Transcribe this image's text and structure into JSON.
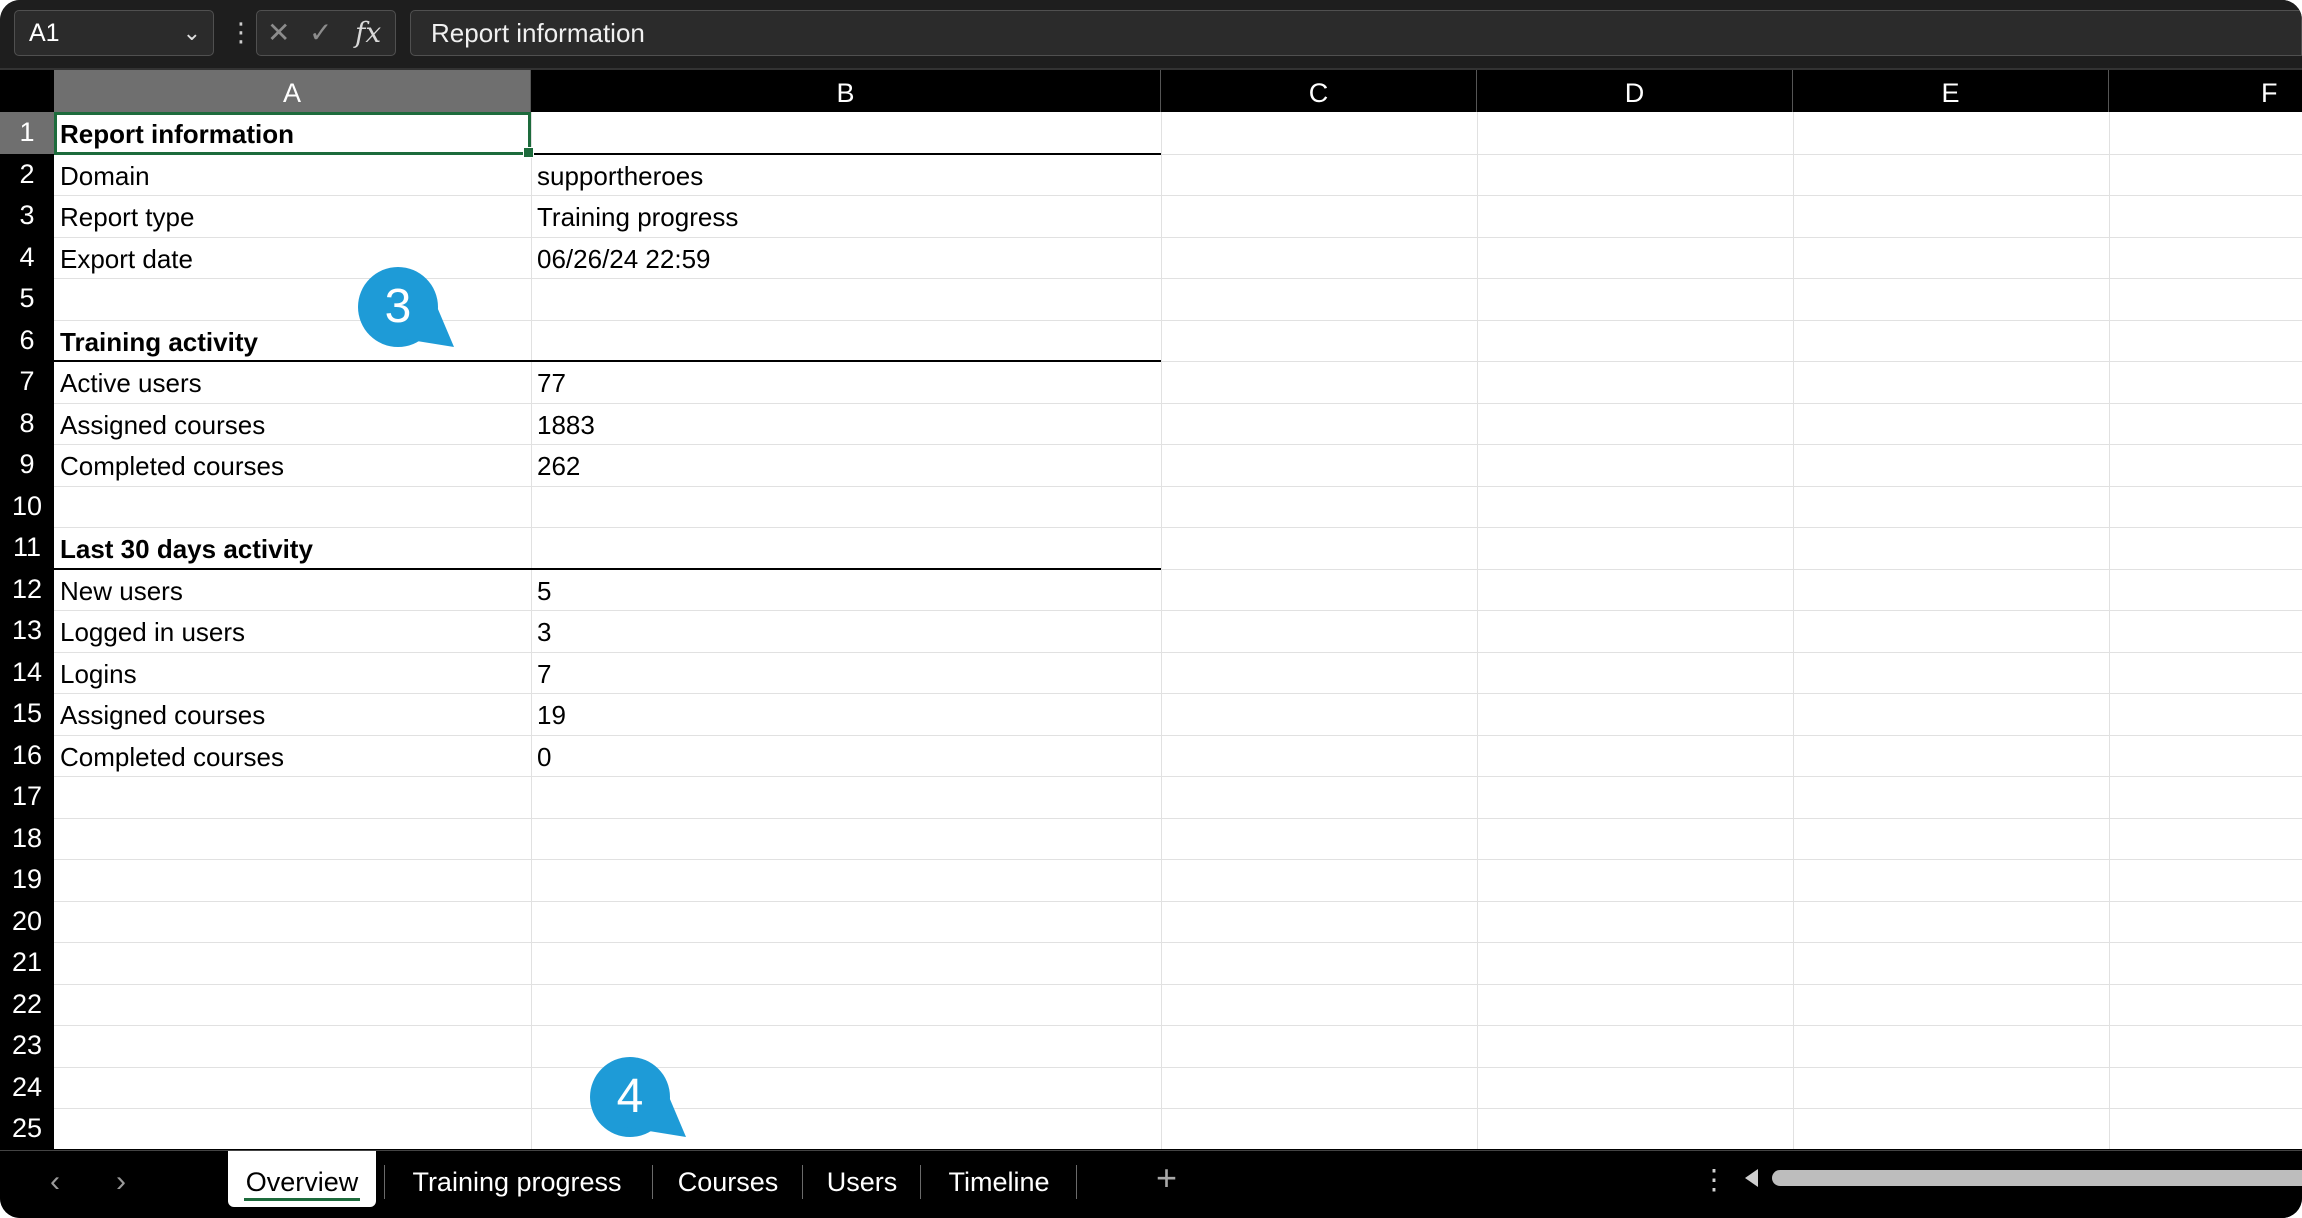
{
  "formula_bar": {
    "name_box": "A1",
    "formula": "Report information",
    "fx": "fx"
  },
  "columns": [
    "A",
    "B",
    "C",
    "D",
    "E",
    "F"
  ],
  "rows": [
    "1",
    "2",
    "3",
    "4",
    "5",
    "6",
    "7",
    "8",
    "9",
    "10",
    "11",
    "12",
    "13",
    "14",
    "15",
    "16",
    "17",
    "18",
    "19",
    "20",
    "21",
    "22",
    "23",
    "24",
    "25"
  ],
  "cells": {
    "r1": {
      "a": "Report information",
      "b": ""
    },
    "r2": {
      "a": "Domain",
      "b": "supportheroes"
    },
    "r3": {
      "a": "Report type",
      "b": "Training progress"
    },
    "r4": {
      "a": "Export date",
      "b": "06/26/24 22:59"
    },
    "r6": {
      "a": "Training activity",
      "b": ""
    },
    "r7": {
      "a": "Active users",
      "b": "77"
    },
    "r8": {
      "a": "Assigned courses",
      "b": "1883"
    },
    "r9": {
      "a": "Completed courses",
      "b": "262"
    },
    "r11": {
      "a": "Last 30 days activity",
      "b": ""
    },
    "r12": {
      "a": "New users",
      "b": "5"
    },
    "r13": {
      "a": "Logged in users",
      "b": "3"
    },
    "r14": {
      "a": "Logins",
      "b": "7"
    },
    "r15": {
      "a": "Assigned courses",
      "b": "19"
    },
    "r16": {
      "a": "Completed courses",
      "b": "0"
    }
  },
  "callouts": {
    "c3": "3",
    "c4": "4"
  },
  "tabs": {
    "overview": "Overview",
    "training_progress": "Training progress",
    "courses": "Courses",
    "users": "Users",
    "timeline": "Timeline",
    "active": "Overview"
  },
  "colors": {
    "accent_green": "#1d6b3c",
    "callout_blue": "#1e9bd7"
  },
  "icons": {
    "chevron": "chevron-down-icon",
    "cancel": "close-icon",
    "enter": "check-icon",
    "add": "plus-icon"
  }
}
